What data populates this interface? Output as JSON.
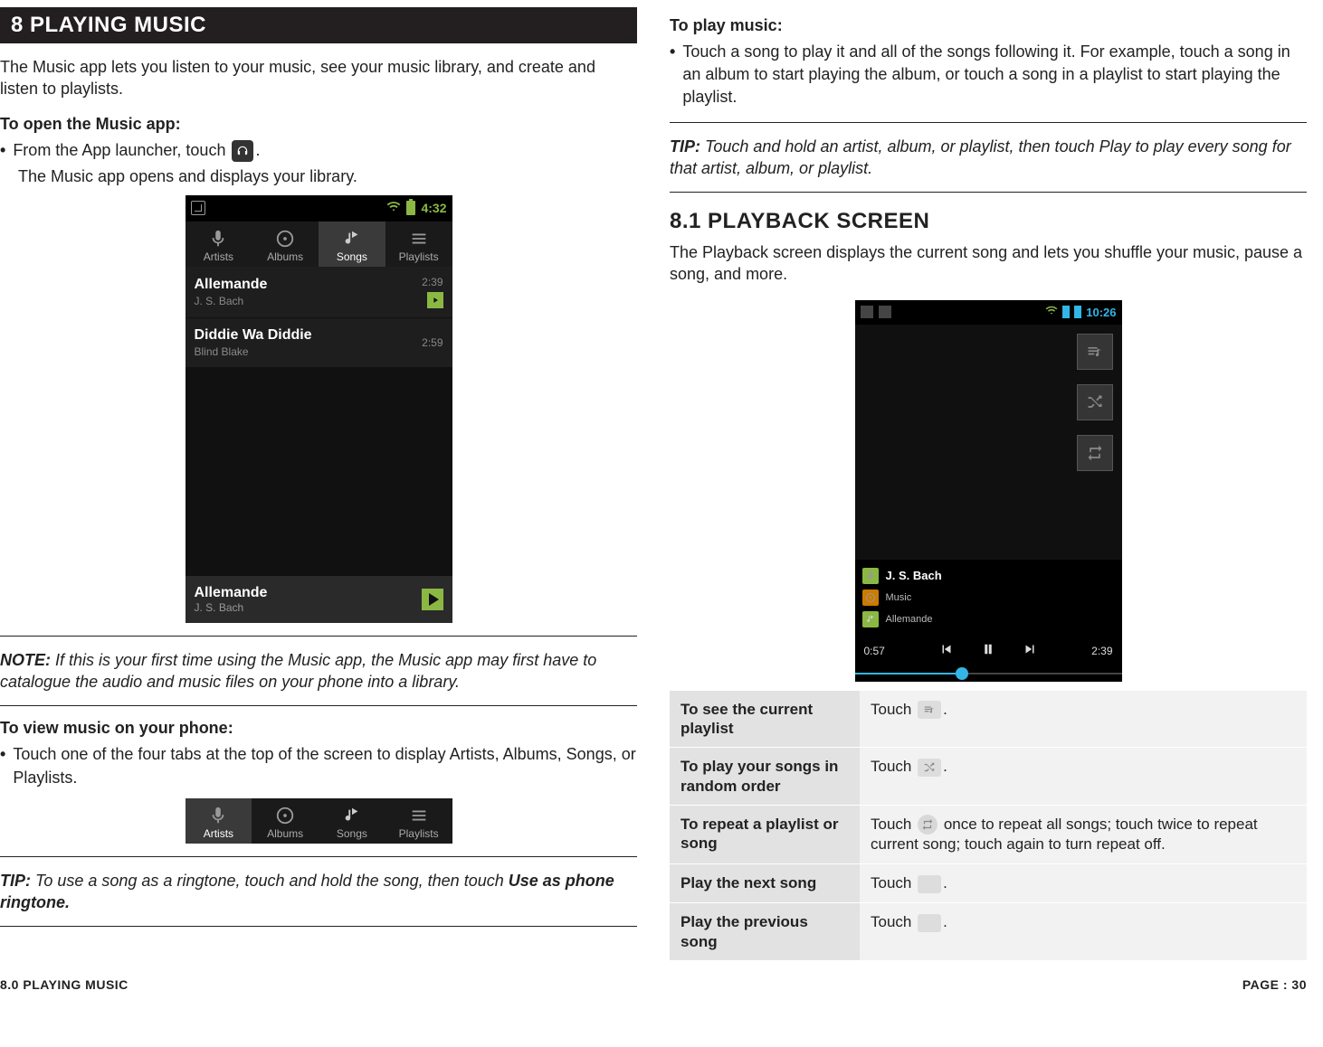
{
  "left": {
    "section_title": "8 PLAYING MUSIC",
    "intro": "The Music app lets you listen to your music, see your music library, and create and listen to playlists.",
    "open_head": "To open the Music app:",
    "open_bullet_pre": "From the App launcher, touch",
    "open_bullet_post": ".",
    "open_result": "The Music app opens and displays your library.",
    "note_lead": "NOTE:",
    "note_text": " If this is your first time using the Music app, the Music app may first have to catalogue the audio and music files on your phone into a library.",
    "view_head": "To view music on your phone:",
    "view_bullet": "Touch one of the four tabs at the top of the screen to display Artists, Albums, Songs, or Playlists.",
    "tip_lead": "TIP:",
    "tip_text_pre": " To use a song as a ringtone, touch and hold the song, then touch ",
    "tip_bold": "Use as phone ringtone.",
    "screenshot1": {
      "time": "4:32",
      "tabs": [
        "Artists",
        "Albums",
        "Songs",
        "Playlists"
      ],
      "selected_tab_index": 2,
      "songs": [
        {
          "title": "Allemande",
          "artist": "J. S. Bach",
          "duration": "2:39",
          "playing": true
        },
        {
          "title": "Diddie Wa Diddie",
          "artist": "Blind Blake",
          "duration": "2:59",
          "playing": false
        }
      ],
      "nowplaying": {
        "title": "Allemande",
        "artist": "J. S. Bach"
      }
    }
  },
  "right": {
    "play_head": "To play music:",
    "play_bullet": "Touch a song to play it and all of the songs following it. For example, touch a song in an album to start playing the album, or touch a song in a playlist to start playing the playlist.",
    "tip2_lead": "TIP:",
    "tip2_text": " Touch and hold an artist, album, or playlist, then touch Play to play every song for that artist, album, or playlist.",
    "h2": "8.1 PLAYBACK SCREEN",
    "h2_intro": "The Playback screen displays the current song and lets you shuffle your music, pause a song, and more.",
    "screenshot2": {
      "time": "10:26",
      "artist": "J. S. Bach",
      "album": "Music",
      "song": "Allemande",
      "elapsed": "0:57",
      "total": "2:39"
    },
    "table": {
      "r1": {
        "label": "To see the current playlist",
        "pre": "Touch ",
        "post": "."
      },
      "r2": {
        "label": "To play your songs in random order",
        "pre": "Touch ",
        "post": "."
      },
      "r3": {
        "label": "To repeat a playlist or song",
        "pre": "Touch ",
        "post": " once to repeat all songs; touch twice to repeat current song; touch again to turn repeat off."
      },
      "r4": {
        "label": "Play the next song",
        "pre": "Touch ",
        "post": "."
      },
      "r5": {
        "label": "Play the previous song",
        "pre": "Touch ",
        "post": "."
      }
    }
  },
  "footer": {
    "left": "8.0 PLAYING MUSIC",
    "right": "PAGE : 30"
  }
}
